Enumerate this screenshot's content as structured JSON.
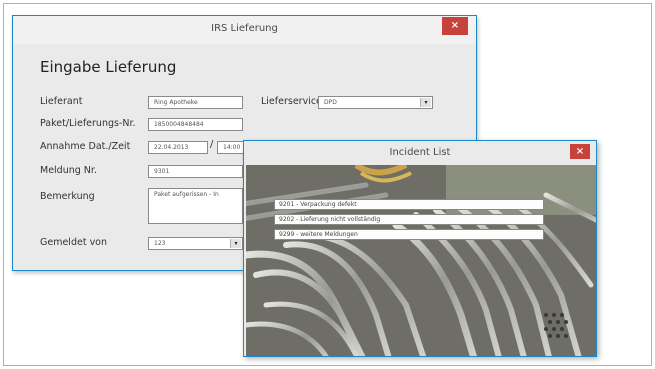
{
  "main_window": {
    "title": "IRS Lieferung",
    "close_label": "×",
    "heading": "Eingabe Lieferung",
    "labels": {
      "lieferant": "Lieferant",
      "paket": "Paket/Lieferungs-Nr.",
      "annahme": "Annahme Dat./Zeit",
      "meldung": "Meldung Nr.",
      "bemerkung": "Bemerkung",
      "gemeldet": "Gemeldet von",
      "lieferservice": "Lieferservice"
    },
    "values": {
      "lieferant": "Ring Apotheke",
      "paket": "1850004848484",
      "datum": "22.04.2013",
      "zeit": "14:00",
      "meldung": "9301",
      "bemerkung": "Paket aufgerissen - In",
      "gemeldet": "123",
      "lieferservice": "DPD"
    },
    "slash": "/",
    "dropdown_glyph": "▾"
  },
  "incident_window": {
    "title": "Incident List",
    "close_label": "×",
    "items": [
      "9201 - Verpackung defekt",
      "9202 - Lieferung nicht vollständig",
      "9299 - weitere Meldungen"
    ]
  }
}
